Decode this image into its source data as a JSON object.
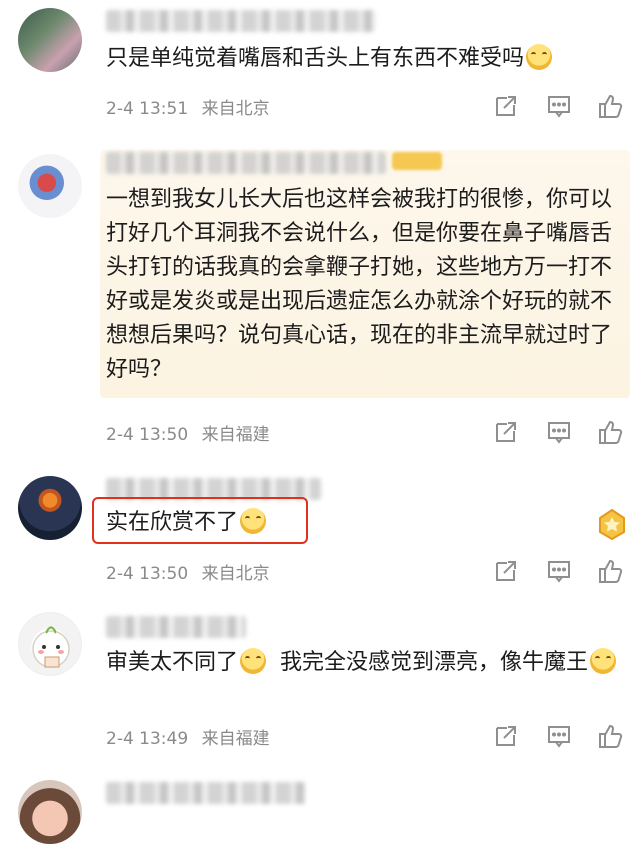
{
  "comments": [
    {
      "text": "只是单纯觉着嘴唇和舌头上有东西不难受吗",
      "has_emoji": true,
      "time": "2-4 13:51",
      "location": "来自北京"
    },
    {
      "text": "一想到我女儿长大后也这样会被我打的很惨，你可以打好几个耳洞我不会说什么，但是你要在鼻子嘴唇舌头打钉的话我真的会拿鞭子打她，这些地方万一打不好或是发炎或是出现后遗症怎么办就涂个好玩的就不想想后果吗？说句真心话，现在的非主流早就过时了好吗？",
      "has_emoji": false,
      "time": "2-4 13:50",
      "location": "来自福建"
    },
    {
      "text": "实在欣赏不了",
      "has_emoji": true,
      "time": "2-4 13:50",
      "location": "来自北京"
    },
    {
      "text_a": "审美太不同了",
      "text_b": "我完全没感觉到漂亮，像牛魔王",
      "time": "2-4 13:49",
      "location": "来自福建"
    }
  ],
  "icons": {
    "share": "share-icon",
    "comment": "comment-icon",
    "like": "like-icon"
  },
  "colors": {
    "highlight": "#e0301e",
    "meta_text": "#8a8a8a",
    "quote_bg": "#fdf7ec"
  }
}
